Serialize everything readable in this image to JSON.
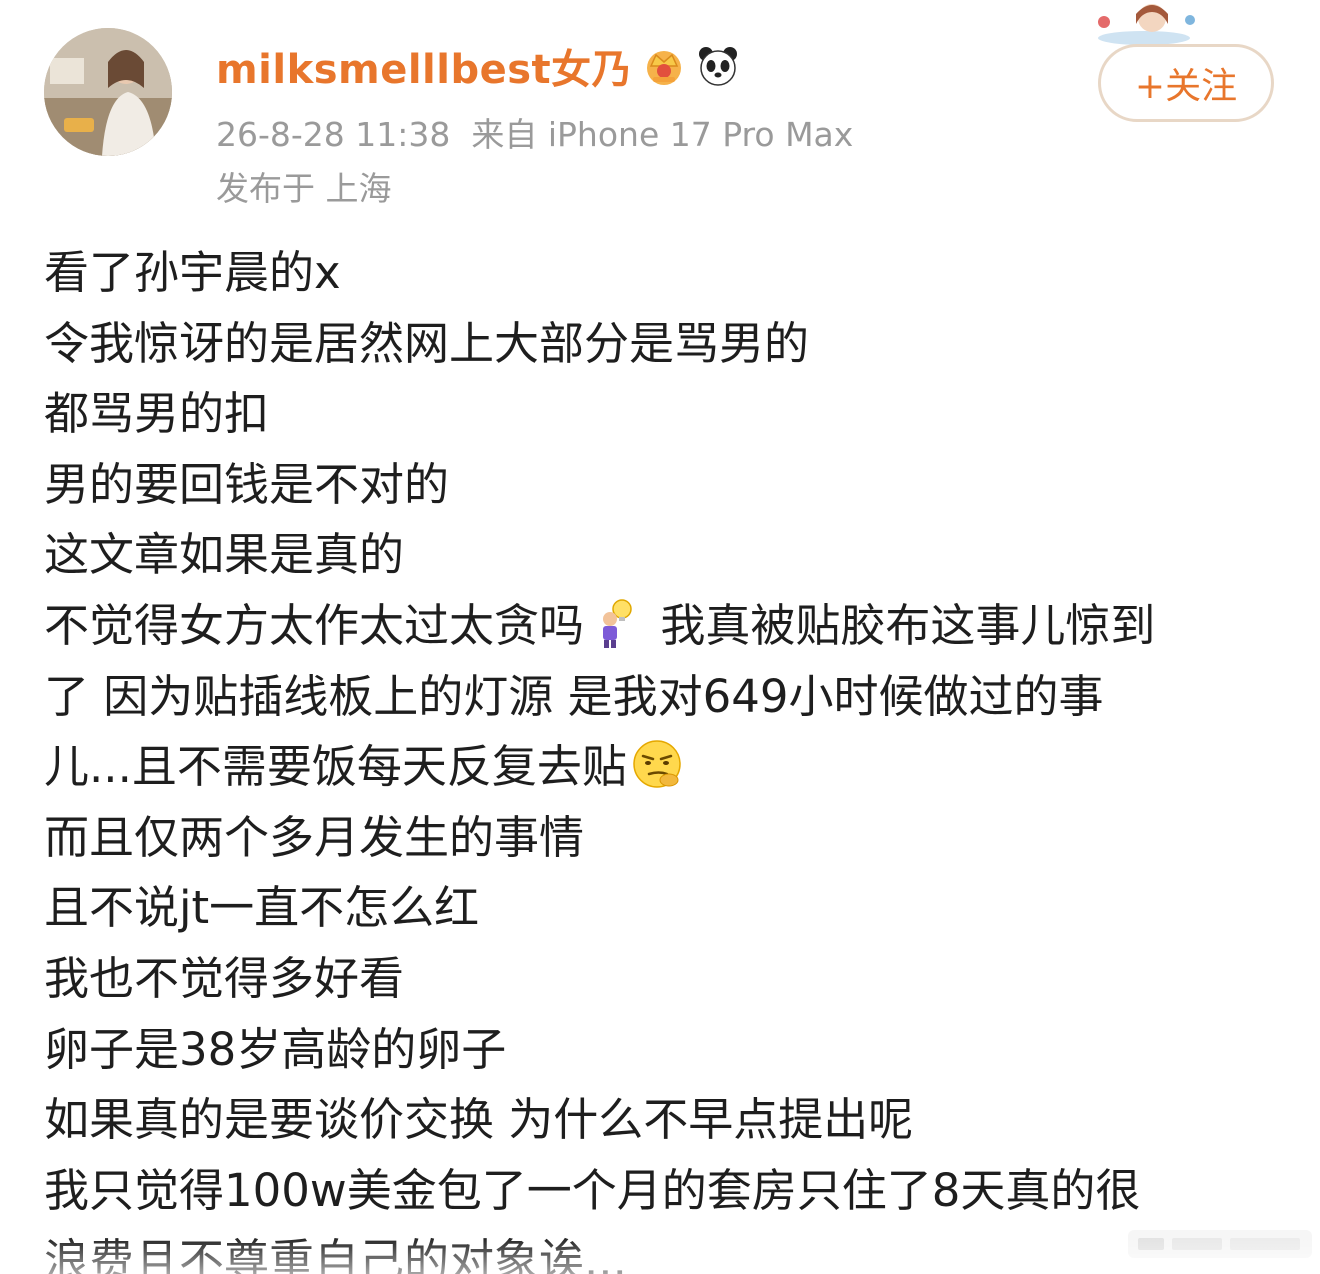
{
  "post": {
    "author": {
      "name": "milksmelllbest女乃",
      "badges": [
        "crown-icon",
        "panda-icon"
      ]
    },
    "timestamp": "26-8-28 11:38",
    "source": "来自 iPhone 17 Pro Max",
    "location": "发布于 上海",
    "follow_label": "+关注",
    "text_lines": [
      "看了孙宇晨的x",
      "令我惊讶的是居然网上大部分是骂男的",
      "都骂男的扣",
      "男的要回钱是不对的",
      "这文章如果是真的",
      "不觉得女方太作太过太贪吗",
      "我真被贴胶布这事儿惊到",
      "了 因为贴插线板上的灯源 是我对649小时候做过的事",
      "儿...且不需要饭每天反复去贴",
      "而且仅两个多月发生的事情",
      "且不说jt一直不怎么红",
      "我也不觉得多好看",
      "卵子是38岁高龄的卵子",
      "如果真的是要谈价交换 为什么不早点提出呢",
      "我只觉得100w美金包了一个月的套房只住了8天真的很",
      "浪费且不尊重自己的对象诶..."
    ],
    "emojis": [
      "thinking-lightbulb-emoji",
      "smirk-thinking-emoji"
    ]
  },
  "colors": {
    "username": "#e8762c",
    "meta": "#9a9a9a",
    "text": "#1e1e1e",
    "follow_border": "#e8d7c6"
  }
}
